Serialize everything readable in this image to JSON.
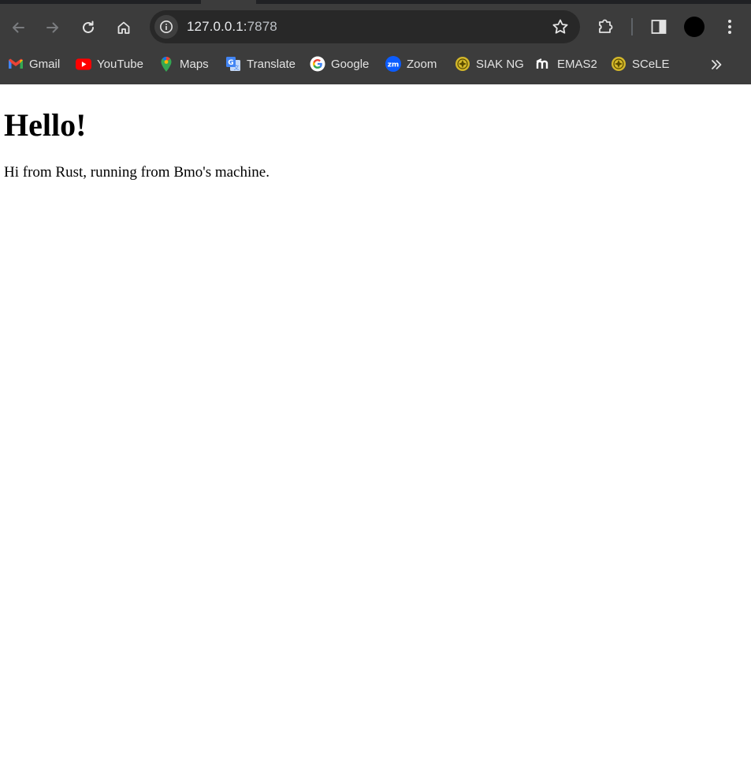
{
  "browser": {
    "url_host": "127.0.0.1:",
    "url_port": "7878",
    "icons": {
      "back": "back-arrow-icon",
      "forward": "forward-arrow-icon",
      "reload": "reload-icon",
      "home": "home-icon",
      "site_info": "info-icon",
      "bookmark_star": "star-icon",
      "extensions": "puzzle-icon",
      "side_panel": "side-panel-icon",
      "profile": "avatar",
      "menu": "kebab-menu-icon",
      "more_bookmarks": "double-chevron-icon"
    },
    "colors": {
      "chrome_bg": "#3c3c3c",
      "omnibox_bg": "#282828",
      "text": "#e3e3e3"
    }
  },
  "bookmarks": [
    {
      "label": "Gmail",
      "icon": "gmail-icon"
    },
    {
      "label": "YouTube",
      "icon": "youtube-icon"
    },
    {
      "label": "Maps",
      "icon": "maps-icon"
    },
    {
      "label": "Translate",
      "icon": "translate-icon"
    },
    {
      "label": "Google",
      "icon": "google-icon"
    },
    {
      "label": "Zoom",
      "icon": "zoom-icon"
    },
    {
      "label": "SIAK NG",
      "icon": "university-seal-icon"
    },
    {
      "label": "EMAS2",
      "icon": "moodle-icon"
    },
    {
      "label": "SCeLE",
      "icon": "university-seal-icon"
    }
  ],
  "page": {
    "heading": "Hello!",
    "body": "Hi from Rust, running from Bmo's machine."
  }
}
